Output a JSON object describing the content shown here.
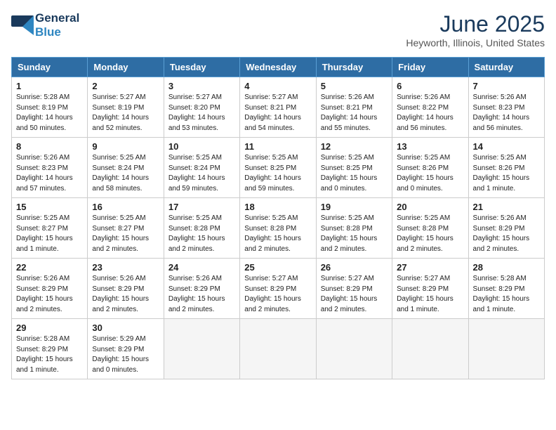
{
  "logo": {
    "general": "General",
    "blue": "Blue"
  },
  "title": "June 2025",
  "subtitle": "Heyworth, Illinois, United States",
  "days_of_week": [
    "Sunday",
    "Monday",
    "Tuesday",
    "Wednesday",
    "Thursday",
    "Friday",
    "Saturday"
  ],
  "weeks": [
    [
      {
        "num": "1",
        "info": "Sunrise: 5:28 AM\nSunset: 8:19 PM\nDaylight: 14 hours\nand 50 minutes."
      },
      {
        "num": "2",
        "info": "Sunrise: 5:27 AM\nSunset: 8:19 PM\nDaylight: 14 hours\nand 52 minutes."
      },
      {
        "num": "3",
        "info": "Sunrise: 5:27 AM\nSunset: 8:20 PM\nDaylight: 14 hours\nand 53 minutes."
      },
      {
        "num": "4",
        "info": "Sunrise: 5:27 AM\nSunset: 8:21 PM\nDaylight: 14 hours\nand 54 minutes."
      },
      {
        "num": "5",
        "info": "Sunrise: 5:26 AM\nSunset: 8:21 PM\nDaylight: 14 hours\nand 55 minutes."
      },
      {
        "num": "6",
        "info": "Sunrise: 5:26 AM\nSunset: 8:22 PM\nDaylight: 14 hours\nand 56 minutes."
      },
      {
        "num": "7",
        "info": "Sunrise: 5:26 AM\nSunset: 8:23 PM\nDaylight: 14 hours\nand 56 minutes."
      }
    ],
    [
      {
        "num": "8",
        "info": "Sunrise: 5:26 AM\nSunset: 8:23 PM\nDaylight: 14 hours\nand 57 minutes."
      },
      {
        "num": "9",
        "info": "Sunrise: 5:25 AM\nSunset: 8:24 PM\nDaylight: 14 hours\nand 58 minutes."
      },
      {
        "num": "10",
        "info": "Sunrise: 5:25 AM\nSunset: 8:24 PM\nDaylight: 14 hours\nand 59 minutes."
      },
      {
        "num": "11",
        "info": "Sunrise: 5:25 AM\nSunset: 8:25 PM\nDaylight: 14 hours\nand 59 minutes."
      },
      {
        "num": "12",
        "info": "Sunrise: 5:25 AM\nSunset: 8:25 PM\nDaylight: 15 hours\nand 0 minutes."
      },
      {
        "num": "13",
        "info": "Sunrise: 5:25 AM\nSunset: 8:26 PM\nDaylight: 15 hours\nand 0 minutes."
      },
      {
        "num": "14",
        "info": "Sunrise: 5:25 AM\nSunset: 8:26 PM\nDaylight: 15 hours\nand 1 minute."
      }
    ],
    [
      {
        "num": "15",
        "info": "Sunrise: 5:25 AM\nSunset: 8:27 PM\nDaylight: 15 hours\nand 1 minute."
      },
      {
        "num": "16",
        "info": "Sunrise: 5:25 AM\nSunset: 8:27 PM\nDaylight: 15 hours\nand 2 minutes."
      },
      {
        "num": "17",
        "info": "Sunrise: 5:25 AM\nSunset: 8:28 PM\nDaylight: 15 hours\nand 2 minutes."
      },
      {
        "num": "18",
        "info": "Sunrise: 5:25 AM\nSunset: 8:28 PM\nDaylight: 15 hours\nand 2 minutes."
      },
      {
        "num": "19",
        "info": "Sunrise: 5:25 AM\nSunset: 8:28 PM\nDaylight: 15 hours\nand 2 minutes."
      },
      {
        "num": "20",
        "info": "Sunrise: 5:25 AM\nSunset: 8:28 PM\nDaylight: 15 hours\nand 2 minutes."
      },
      {
        "num": "21",
        "info": "Sunrise: 5:26 AM\nSunset: 8:29 PM\nDaylight: 15 hours\nand 2 minutes."
      }
    ],
    [
      {
        "num": "22",
        "info": "Sunrise: 5:26 AM\nSunset: 8:29 PM\nDaylight: 15 hours\nand 2 minutes."
      },
      {
        "num": "23",
        "info": "Sunrise: 5:26 AM\nSunset: 8:29 PM\nDaylight: 15 hours\nand 2 minutes."
      },
      {
        "num": "24",
        "info": "Sunrise: 5:26 AM\nSunset: 8:29 PM\nDaylight: 15 hours\nand 2 minutes."
      },
      {
        "num": "25",
        "info": "Sunrise: 5:27 AM\nSunset: 8:29 PM\nDaylight: 15 hours\nand 2 minutes."
      },
      {
        "num": "26",
        "info": "Sunrise: 5:27 AM\nSunset: 8:29 PM\nDaylight: 15 hours\nand 2 minutes."
      },
      {
        "num": "27",
        "info": "Sunrise: 5:27 AM\nSunset: 8:29 PM\nDaylight: 15 hours\nand 1 minute."
      },
      {
        "num": "28",
        "info": "Sunrise: 5:28 AM\nSunset: 8:29 PM\nDaylight: 15 hours\nand 1 minute."
      }
    ],
    [
      {
        "num": "29",
        "info": "Sunrise: 5:28 AM\nSunset: 8:29 PM\nDaylight: 15 hours\nand 1 minute."
      },
      {
        "num": "30",
        "info": "Sunrise: 5:29 AM\nSunset: 8:29 PM\nDaylight: 15 hours\nand 0 minutes."
      },
      {
        "num": "",
        "info": "",
        "empty": true
      },
      {
        "num": "",
        "info": "",
        "empty": true
      },
      {
        "num": "",
        "info": "",
        "empty": true
      },
      {
        "num": "",
        "info": "",
        "empty": true
      },
      {
        "num": "",
        "info": "",
        "empty": true
      }
    ]
  ]
}
